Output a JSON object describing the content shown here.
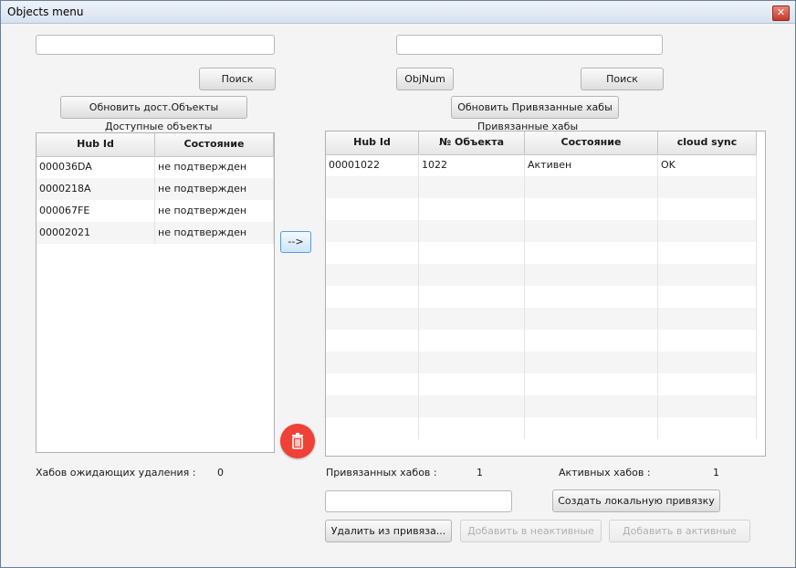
{
  "window": {
    "title": "Objects menu",
    "close_glyph": "✕"
  },
  "left": {
    "search_value": "",
    "search_button": "Поиск",
    "refresh_button": "Обновить дост.Объекты",
    "caption": "Доступные объекты",
    "columns": [
      "Hub Id",
      "Состояние"
    ],
    "rows": [
      [
        "000036DA",
        "не подтвержден"
      ],
      [
        "0000218A",
        "не подтвержден"
      ],
      [
        "000067FE",
        "не подтвержден"
      ],
      [
        "00002021",
        "не подтвержден"
      ]
    ],
    "pending_label": "Хабов ожидающих удаления :",
    "pending_count": "0"
  },
  "middle": {
    "arrow_button": "-->",
    "delete_icon": "trash-icon"
  },
  "right": {
    "search_value": "",
    "objnum_button": "ObjNum",
    "search_button": "Поиск",
    "refresh_button": "Обновить Привязанные хабы",
    "caption": "Привязанные хабы",
    "columns": [
      "Hub Id",
      "№ Объекта",
      "Состояние",
      "cloud sync"
    ],
    "rows": [
      [
        "00001022",
        "1022",
        "Активен",
        "OK"
      ]
    ],
    "bound_label": "Привязанных хабов :",
    "bound_count": "1",
    "active_label": "Активных хабов :",
    "active_count": "1",
    "local_input_value": "",
    "create_local_button": "Создать локальную привязку",
    "remove_button": "Удалить из привяза...",
    "add_inactive_button": "Добавить в неактивные",
    "add_active_button": "Добавить в активные"
  },
  "colors": {
    "accent": "#5a9bd5",
    "danger": "#ef4136"
  }
}
